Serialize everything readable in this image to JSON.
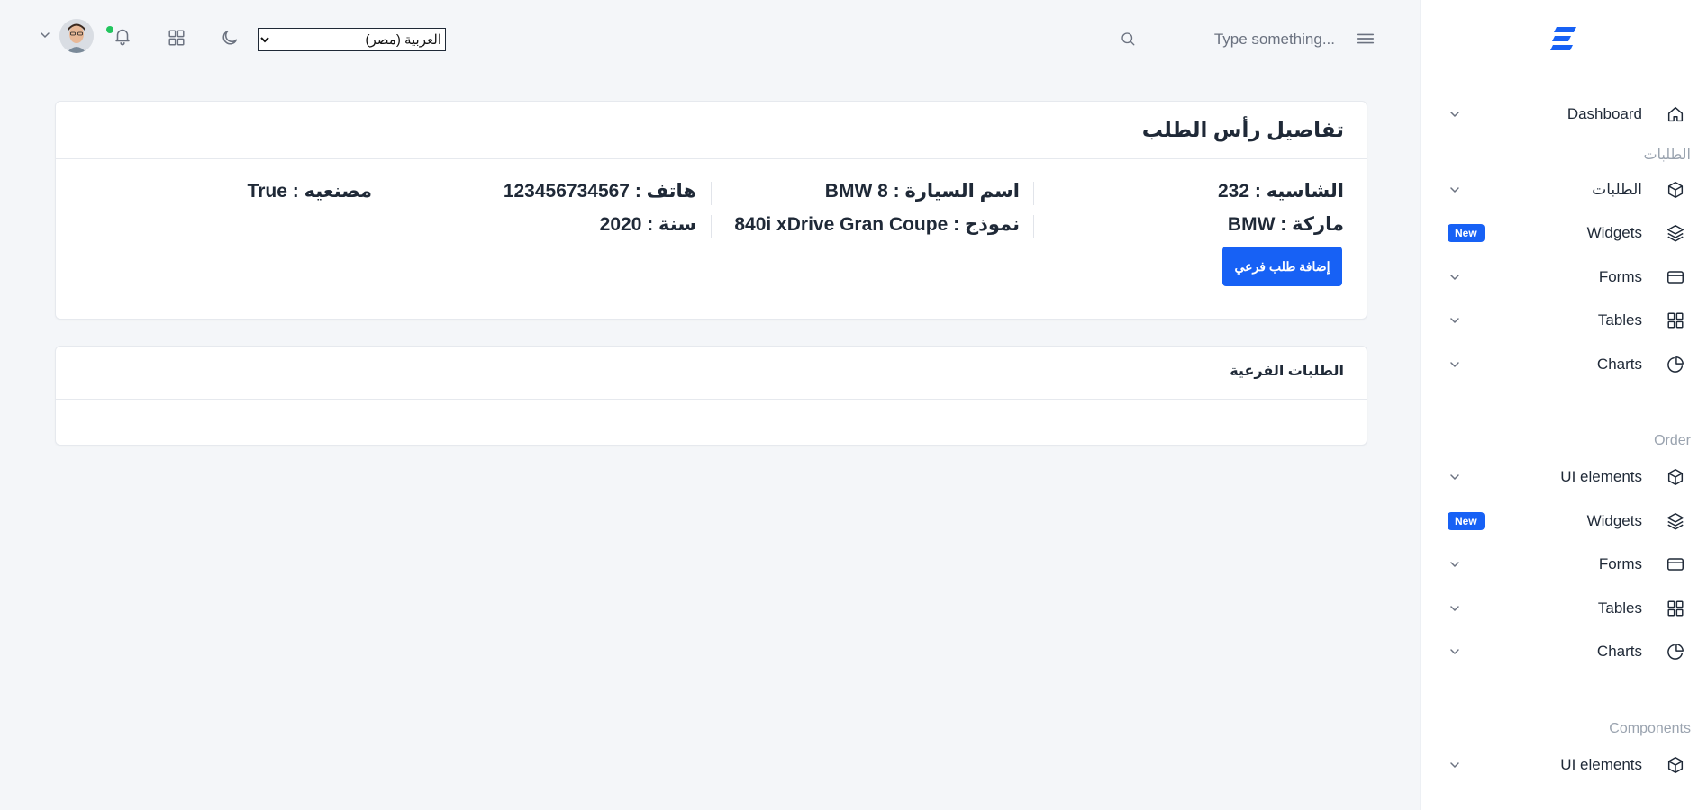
{
  "header": {
    "search_placeholder": "Type something...",
    "language_selected": "العربية (مصر)",
    "status_color": "#22c55e"
  },
  "sidebar": {
    "groups": [
      {
        "label": "",
        "items": [
          {
            "label": "Dashboard",
            "icon": "home-icon",
            "trailing": "chevron"
          }
        ]
      },
      {
        "label": "الطلبات",
        "items": [
          {
            "label": "الطلبات",
            "icon": "cube-icon",
            "trailing": "chevron"
          },
          {
            "label": "Widgets",
            "icon": "layers-icon",
            "trailing": "badge",
            "badge": "New"
          },
          {
            "label": "Forms",
            "icon": "card-icon",
            "trailing": "chevron"
          },
          {
            "label": "Tables",
            "icon": "grid-icon",
            "trailing": "chevron"
          },
          {
            "label": "Charts",
            "icon": "pie-chart-icon",
            "trailing": "chevron"
          }
        ]
      },
      {
        "label": "Order",
        "items": [
          {
            "label": "UI elements",
            "icon": "cube-icon",
            "trailing": "chevron"
          },
          {
            "label": "Widgets",
            "icon": "layers-icon",
            "trailing": "badge",
            "badge": "New"
          },
          {
            "label": "Forms",
            "icon": "card-icon",
            "trailing": "chevron"
          },
          {
            "label": "Tables",
            "icon": "grid-icon",
            "trailing": "chevron"
          },
          {
            "label": "Charts",
            "icon": "pie-chart-icon",
            "trailing": "chevron"
          }
        ]
      },
      {
        "label": "Components",
        "items": [
          {
            "label": "UI elements",
            "icon": "cube-icon",
            "trailing": "chevron"
          }
        ]
      }
    ]
  },
  "order_header": {
    "title": "تفاصيل رأس الطلب",
    "fields": {
      "chassis": "الشاسيه : 232",
      "car_name": "اسم السيارة : BMW 8",
      "phone": "هاتف : 123456734567",
      "manufactured": "مصنعيه : True",
      "brand": "ماركة : BMW",
      "model": "نموذج : 840i xDrive Gran Coupe",
      "year": "سنة : 2020"
    },
    "add_sub_order_button": "إضافة طلب فرعي"
  },
  "sub_orders": {
    "title": "الطلبات الفرعية"
  },
  "colors": {
    "primary": "#1761f5",
    "background": "#f4f6f9",
    "card": "#ffffff"
  }
}
